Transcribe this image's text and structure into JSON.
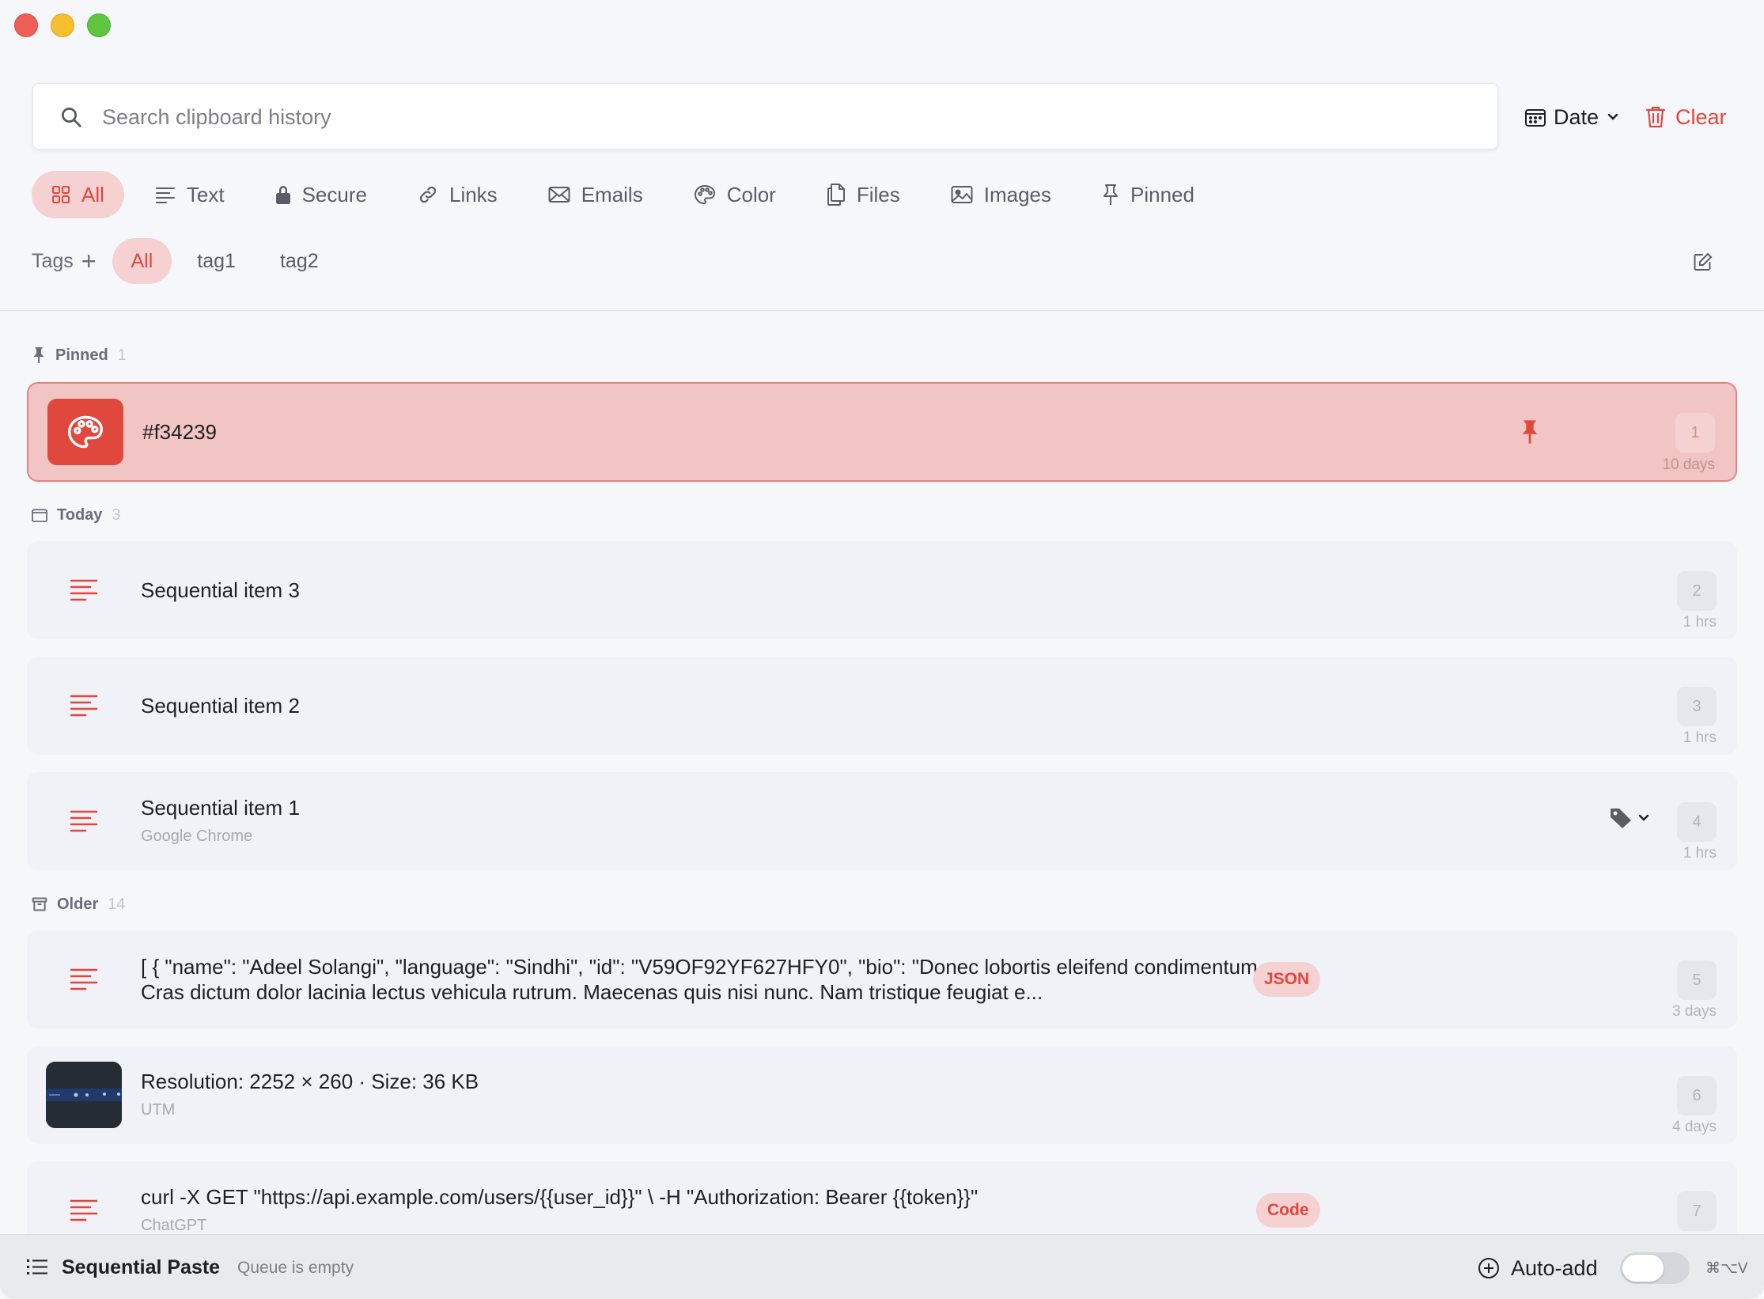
{
  "search": {
    "placeholder": "Search clipboard history"
  },
  "sort": {
    "label": "Date"
  },
  "clear": {
    "label": "Clear"
  },
  "filters": [
    {
      "label": "All",
      "icon": "grid-icon"
    },
    {
      "label": "Text",
      "icon": "text-lines-icon"
    },
    {
      "label": "Secure",
      "icon": "lock-icon"
    },
    {
      "label": "Links",
      "icon": "link-icon"
    },
    {
      "label": "Emails",
      "icon": "envelope-icon"
    },
    {
      "label": "Color",
      "icon": "palette-icon"
    },
    {
      "label": "Files",
      "icon": "files-icon"
    },
    {
      "label": "Images",
      "icon": "image-icon"
    },
    {
      "label": "Pinned",
      "icon": "pin-icon"
    }
  ],
  "tags": {
    "label": "Tags",
    "add": "+",
    "items": [
      "All",
      "tag1",
      "tag2"
    ]
  },
  "sections": {
    "pinned": {
      "label": "Pinned",
      "count": "1"
    },
    "today": {
      "label": "Today",
      "count": "3"
    },
    "older": {
      "label": "Older",
      "count": "14"
    }
  },
  "items": [
    {
      "title": "#f34239",
      "index": "1",
      "age": "10 days"
    },
    {
      "title": "Sequential item 3",
      "index": "2",
      "age": "1 hrs"
    },
    {
      "title": "Sequential item 2",
      "index": "3",
      "age": "1 hrs"
    },
    {
      "title": "Sequential item 1",
      "source": "Google Chrome",
      "index": "4",
      "age": "1 hrs"
    },
    {
      "title": "[ { \"name\": \"Adeel Solangi\", \"language\": \"Sindhi\", \"id\": \"V59OF92YF627HFY0\", \"bio\": \"Donec lobortis eleifend condimentum. Cras dictum dolor lacinia lectus vehicula rutrum. Maecenas quis nisi nunc. Nam tristique feugiat e...",
      "badge": "JSON",
      "index": "5",
      "age": "3 days"
    },
    {
      "title": "Resolution: 2252 × 260 · Size: 36 KB",
      "source": "UTM",
      "index": "6",
      "age": "4 days"
    },
    {
      "title": "curl -X GET \"https://api.example.com/users/{{user_id}}\" \\ -H \"Authorization: Bearer {{token}}\"",
      "source": "ChatGPT",
      "badge": "Code",
      "index": "7"
    }
  ],
  "bottom": {
    "title": "Sequential Paste",
    "status": "Queue is empty",
    "autoadd": "Auto-add",
    "shortcut": "⌘⌥V"
  },
  "colors": {
    "accent": "#e0473d",
    "pinned_bg": "#f0c5c3",
    "swatch": "#f34239"
  }
}
